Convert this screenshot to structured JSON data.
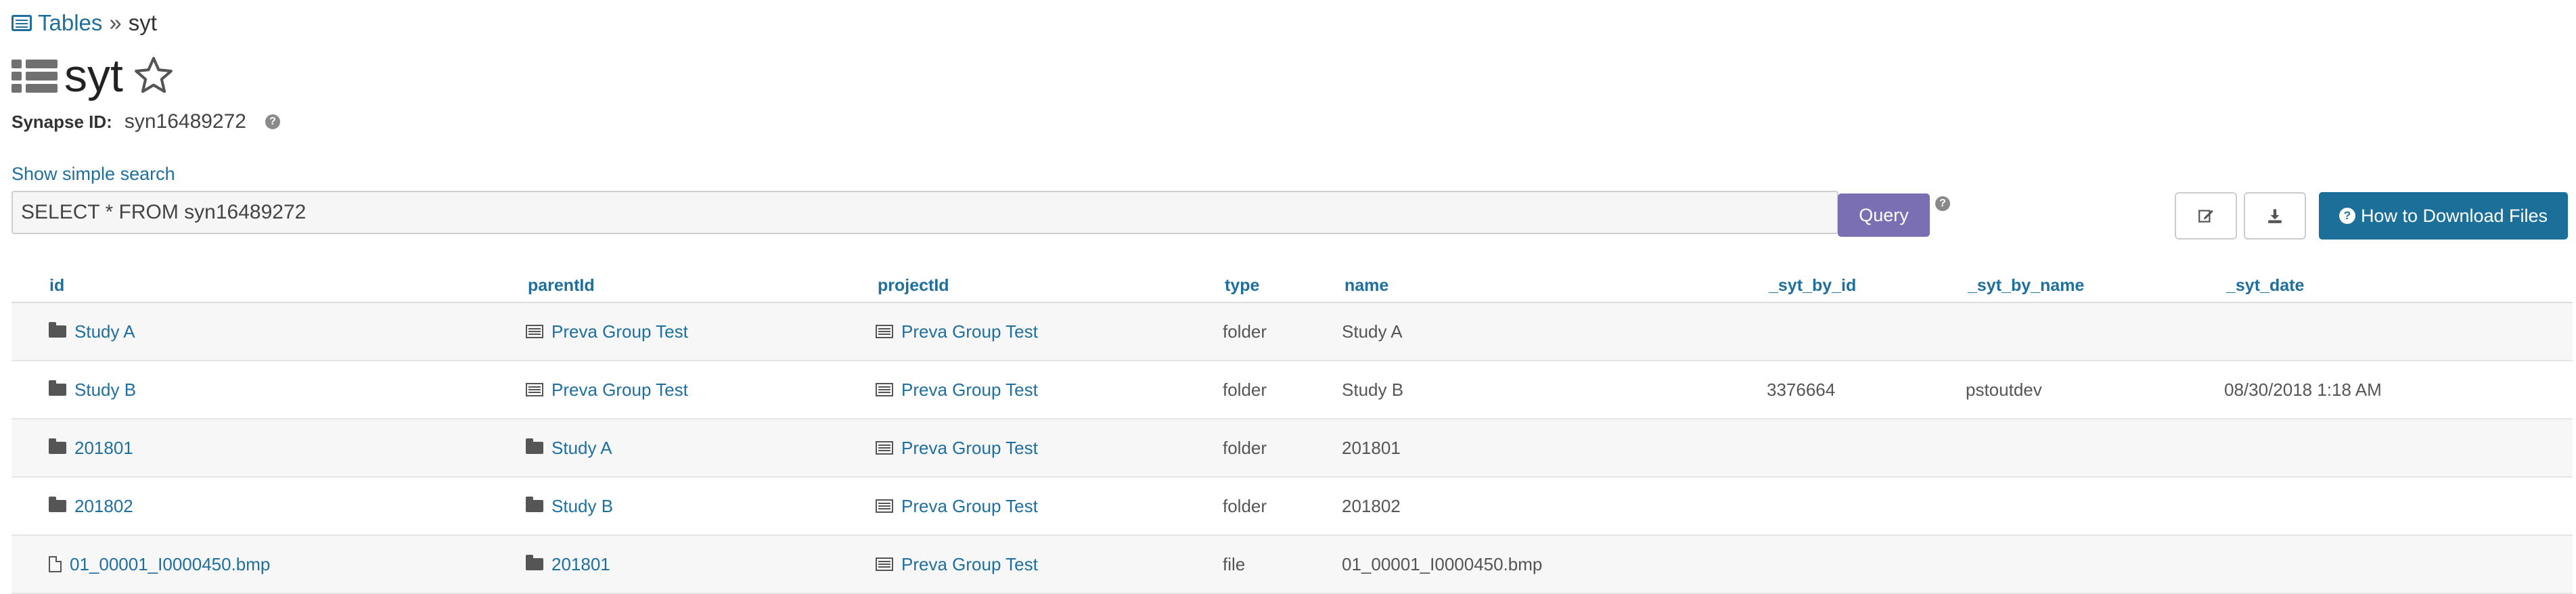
{
  "breadcrumb": {
    "root": "Tables",
    "separator": "»",
    "current": "syt"
  },
  "title": "syt",
  "synapse": {
    "label": "Synapse ID:",
    "value": "syn16489272"
  },
  "search": {
    "toggle_label": "Show simple search",
    "query": "SELECT * FROM syn16489272",
    "button_label": "Query"
  },
  "toolbar": {
    "how_to_download_label": "How to Download Files"
  },
  "table": {
    "columns": [
      "id",
      "parentId",
      "projectId",
      "type",
      "name",
      "_syt_by_id",
      "_syt_by_name",
      "_syt_date"
    ],
    "rows": [
      {
        "id": "Study A",
        "id_icon": "folder-icon",
        "parent": "Preva Group Test",
        "parent_icon": "table-icon",
        "project": "Preva Group Test",
        "type": "folder",
        "name": "Study A",
        "by_id": "",
        "by_name": "",
        "date": ""
      },
      {
        "id": "Study B",
        "id_icon": "folder-icon",
        "parent": "Preva Group Test",
        "parent_icon": "table-icon",
        "project": "Preva Group Test",
        "type": "folder",
        "name": "Study B",
        "by_id": "3376664",
        "by_name": "pstoutdev",
        "date": "08/30/2018 1:18 AM"
      },
      {
        "id": "201801",
        "id_icon": "folder-icon",
        "parent": "Study A",
        "parent_icon": "folder-icon",
        "project": "Preva Group Test",
        "type": "folder",
        "name": "201801",
        "by_id": "",
        "by_name": "",
        "date": ""
      },
      {
        "id": "201802",
        "id_icon": "folder-icon",
        "parent": "Study B",
        "parent_icon": "folder-icon",
        "project": "Preva Group Test",
        "type": "folder",
        "name": "201802",
        "by_id": "",
        "by_name": "",
        "date": ""
      },
      {
        "id": "01_00001_I0000450.bmp",
        "id_icon": "file-icon",
        "parent": "201801",
        "parent_icon": "folder-icon",
        "project": "Preva Group Test",
        "type": "file",
        "name": "01_00001_I0000450.bmp",
        "by_id": "",
        "by_name": "",
        "date": ""
      }
    ]
  },
  "colors": {
    "link": "#1f6f9e",
    "query_button": "#7a6fb3",
    "primary_button": "#1c6f99"
  }
}
